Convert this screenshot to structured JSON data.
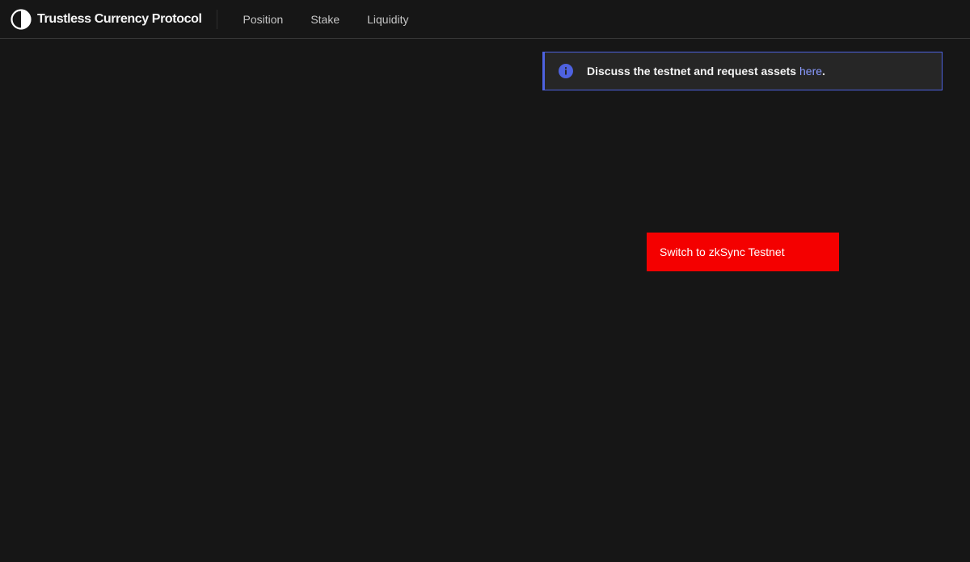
{
  "app": {
    "brand_name": "Trustless Currency Protocol",
    "logo_icon": "half-circle-logo-icon"
  },
  "nav": {
    "items": [
      {
        "label": "Position"
      },
      {
        "label": "Stake"
      },
      {
        "label": "Liquidity"
      }
    ]
  },
  "notice": {
    "icon": "info-icon",
    "text": "Discuss the testnet and request assets ",
    "link_label": "here",
    "trailing": ".",
    "accent_color": "#4e62e0"
  },
  "actions": {
    "switch_network_label": "Switch to zkSync Testnet",
    "button_color": "#f40000"
  },
  "theme": {
    "background": "#161616",
    "text": "#f4f4f4"
  }
}
